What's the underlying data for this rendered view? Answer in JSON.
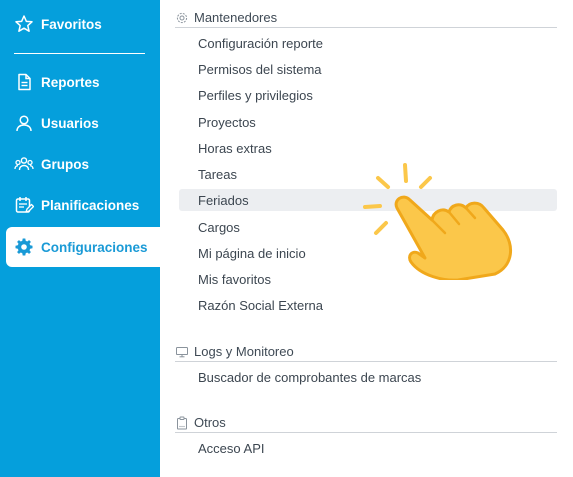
{
  "sidebar": {
    "items": [
      {
        "label": "Favoritos",
        "icon": "star-icon"
      },
      {
        "label": "Reportes",
        "icon": "document-icon"
      },
      {
        "label": "Usuarios",
        "icon": "user-icon"
      },
      {
        "label": "Grupos",
        "icon": "group-icon"
      },
      {
        "label": "Planificaciones",
        "icon": "calendar-edit-icon"
      },
      {
        "label": "Configuraciones",
        "icon": "gear-icon",
        "active": true
      }
    ],
    "background": "#059fdc"
  },
  "sections": [
    {
      "title": "Mantenedores",
      "icon": "gear-outline-icon",
      "links": [
        "Configuración reporte",
        "Permisos del sistema",
        "Perfiles y privilegios",
        "Proyectos",
        "Horas extras",
        "Tareas",
        "Feriados",
        "Cargos",
        "Mi página de inicio",
        "Mis favoritos",
        "Razón Social Externa"
      ]
    },
    {
      "title": "Logs y Monitoreo",
      "icon": "monitor-icon",
      "links": [
        "Buscador de comprobantes de marcas"
      ]
    },
    {
      "title": "Otros",
      "icon": "clipboard-icon",
      "links": [
        "Acceso API"
      ]
    }
  ],
  "highlighted_link": "Feriados",
  "pointer_icon": "pointing-hand-icon",
  "colors": {
    "accent": "#059fdc",
    "hand": "#fbc74a",
    "hand_outline": "#f0a81b"
  }
}
